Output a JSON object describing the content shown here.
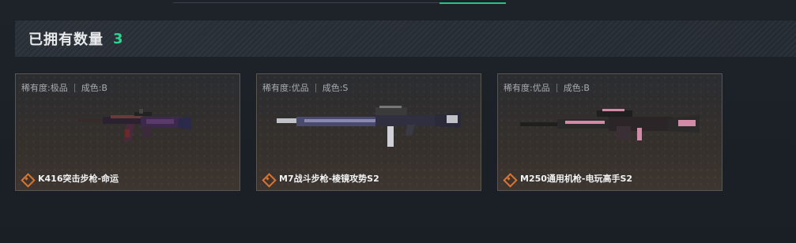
{
  "topbar": {
    "crumbs": "已拥有数量"
  },
  "owned": {
    "title": "已拥有数量",
    "count": "3",
    "count_color": "#29d691"
  },
  "cards": [
    {
      "rarity": "稀有度:极品",
      "condition": "成色:B",
      "name": "K416突击步枪-命运",
      "weapon_icon": "assault-rifle-k416"
    },
    {
      "rarity": "稀有度:优品",
      "condition": "成色:S",
      "name": "M7战斗步枪-棱镜攻势S2",
      "weapon_icon": "battle-rifle-m7"
    },
    {
      "rarity": "稀有度:优品",
      "condition": "成色:B",
      "name": "M250通用机枪-电玩高手S2",
      "weapon_icon": "machine-gun-m250"
    }
  ],
  "colors": {
    "accent": "#29d691",
    "rarity_diamond": "#d8742f",
    "card_border": "#5b5550"
  }
}
